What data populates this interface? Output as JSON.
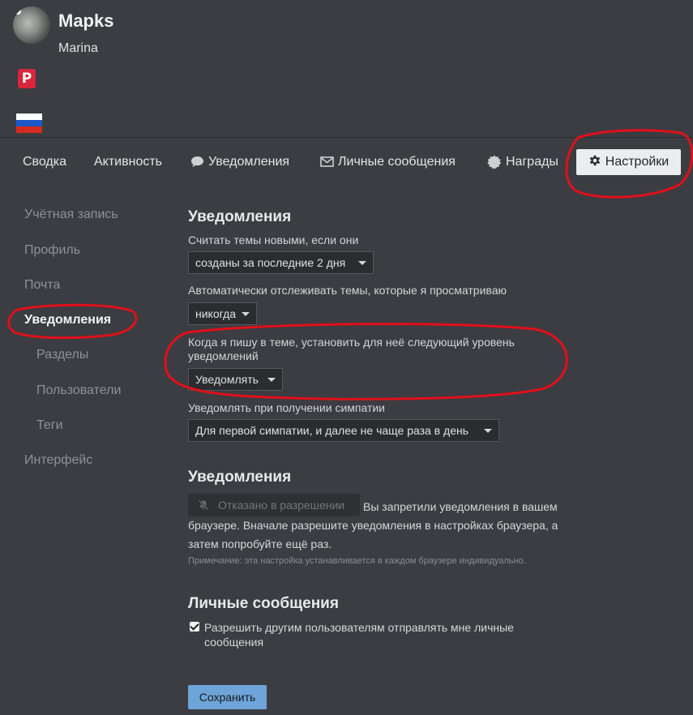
{
  "user": {
    "name": "Mapks",
    "title": "Marina",
    "badge": "P"
  },
  "flag": {
    "colors": [
      "#ffffff",
      "#1c57c7",
      "#d52b1e"
    ]
  },
  "tabs": {
    "summary": "Сводка",
    "activity": "Активность",
    "notifications": "Уведомления",
    "messages": "Личные сообщения",
    "badges": "Награды",
    "settings": "Настройки"
  },
  "sidebar": {
    "account": "Учётная запись",
    "profile": "Профиль",
    "email": "Почта",
    "notifications": "Уведомления",
    "categories": "Разделы",
    "users": "Пользователи",
    "tags": "Теги",
    "interface": "Интерфейс"
  },
  "notifications": {
    "heading": "Уведомления",
    "new_topics_label": "Считать темы новыми, если они",
    "new_topics_value": "созданы за последние 2 дня",
    "auto_track_label": "Автоматически отслеживать темы, которые я просматриваю",
    "auto_track_value": "никогда",
    "on_post_label": "Когда я пишу в теме, установить для неё следующий уровень уведомлений",
    "on_post_value": "Уведомлять",
    "on_like_label": "Уведомлять при получении симпатии",
    "on_like_value": "Для первой симпатии, и далее не чаще раза в день"
  },
  "desktop": {
    "heading": "Уведомления",
    "denied_button": "Отказано в разрешении",
    "denied_text": "Вы запретили уведомления в вашем браузере. Вначале разрешите уведомления в настройках браузера, а затем попробуйте ещё раз.",
    "note": "Примечание: эта настройка устанавливается в каждом браузере индивидуально."
  },
  "pm": {
    "heading": "Личные сообщения",
    "allow_label": "Разрешить другим пользователям отправлять мне личные сообщения",
    "allow_checked": true
  },
  "save_label": "Сохранить",
  "colors": {
    "accent": "#6ea4d8",
    "annotation": "#e0101a",
    "background": "#3b3d42"
  }
}
